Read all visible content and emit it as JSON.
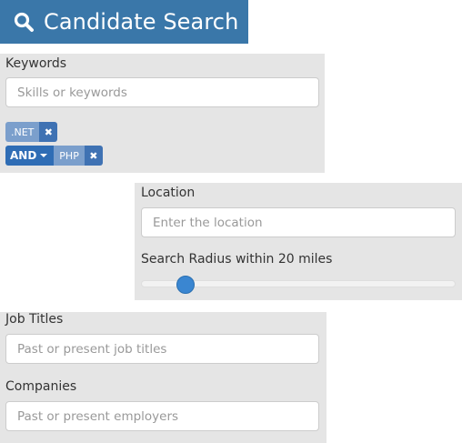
{
  "header": {
    "title": "Candidate Search",
    "icon": "search-icon"
  },
  "keywords": {
    "label": "Keywords",
    "placeholder": "Skills or keywords",
    "value": "",
    "tags": [
      {
        "text": ".NET",
        "operator": ""
      },
      {
        "text": "PHP",
        "operator": "AND"
      }
    ]
  },
  "location": {
    "label": "Location",
    "placeholder": "Enter the location",
    "value": "",
    "radius_label": "Search Radius within 20 miles",
    "radius_fraction": 0.12
  },
  "job_titles": {
    "label": "Job Titles",
    "placeholder": "Past or present job titles",
    "value": ""
  },
  "companies": {
    "label": "Companies",
    "placeholder": "Past or present employers",
    "value": ""
  },
  "colors": {
    "header_bg": "#3a77a9",
    "panel_bg": "#e5e5e5",
    "tag_operator": "#2f6db5",
    "tag_text": "#7b9fcc",
    "slider_handle": "#3a86d1"
  }
}
